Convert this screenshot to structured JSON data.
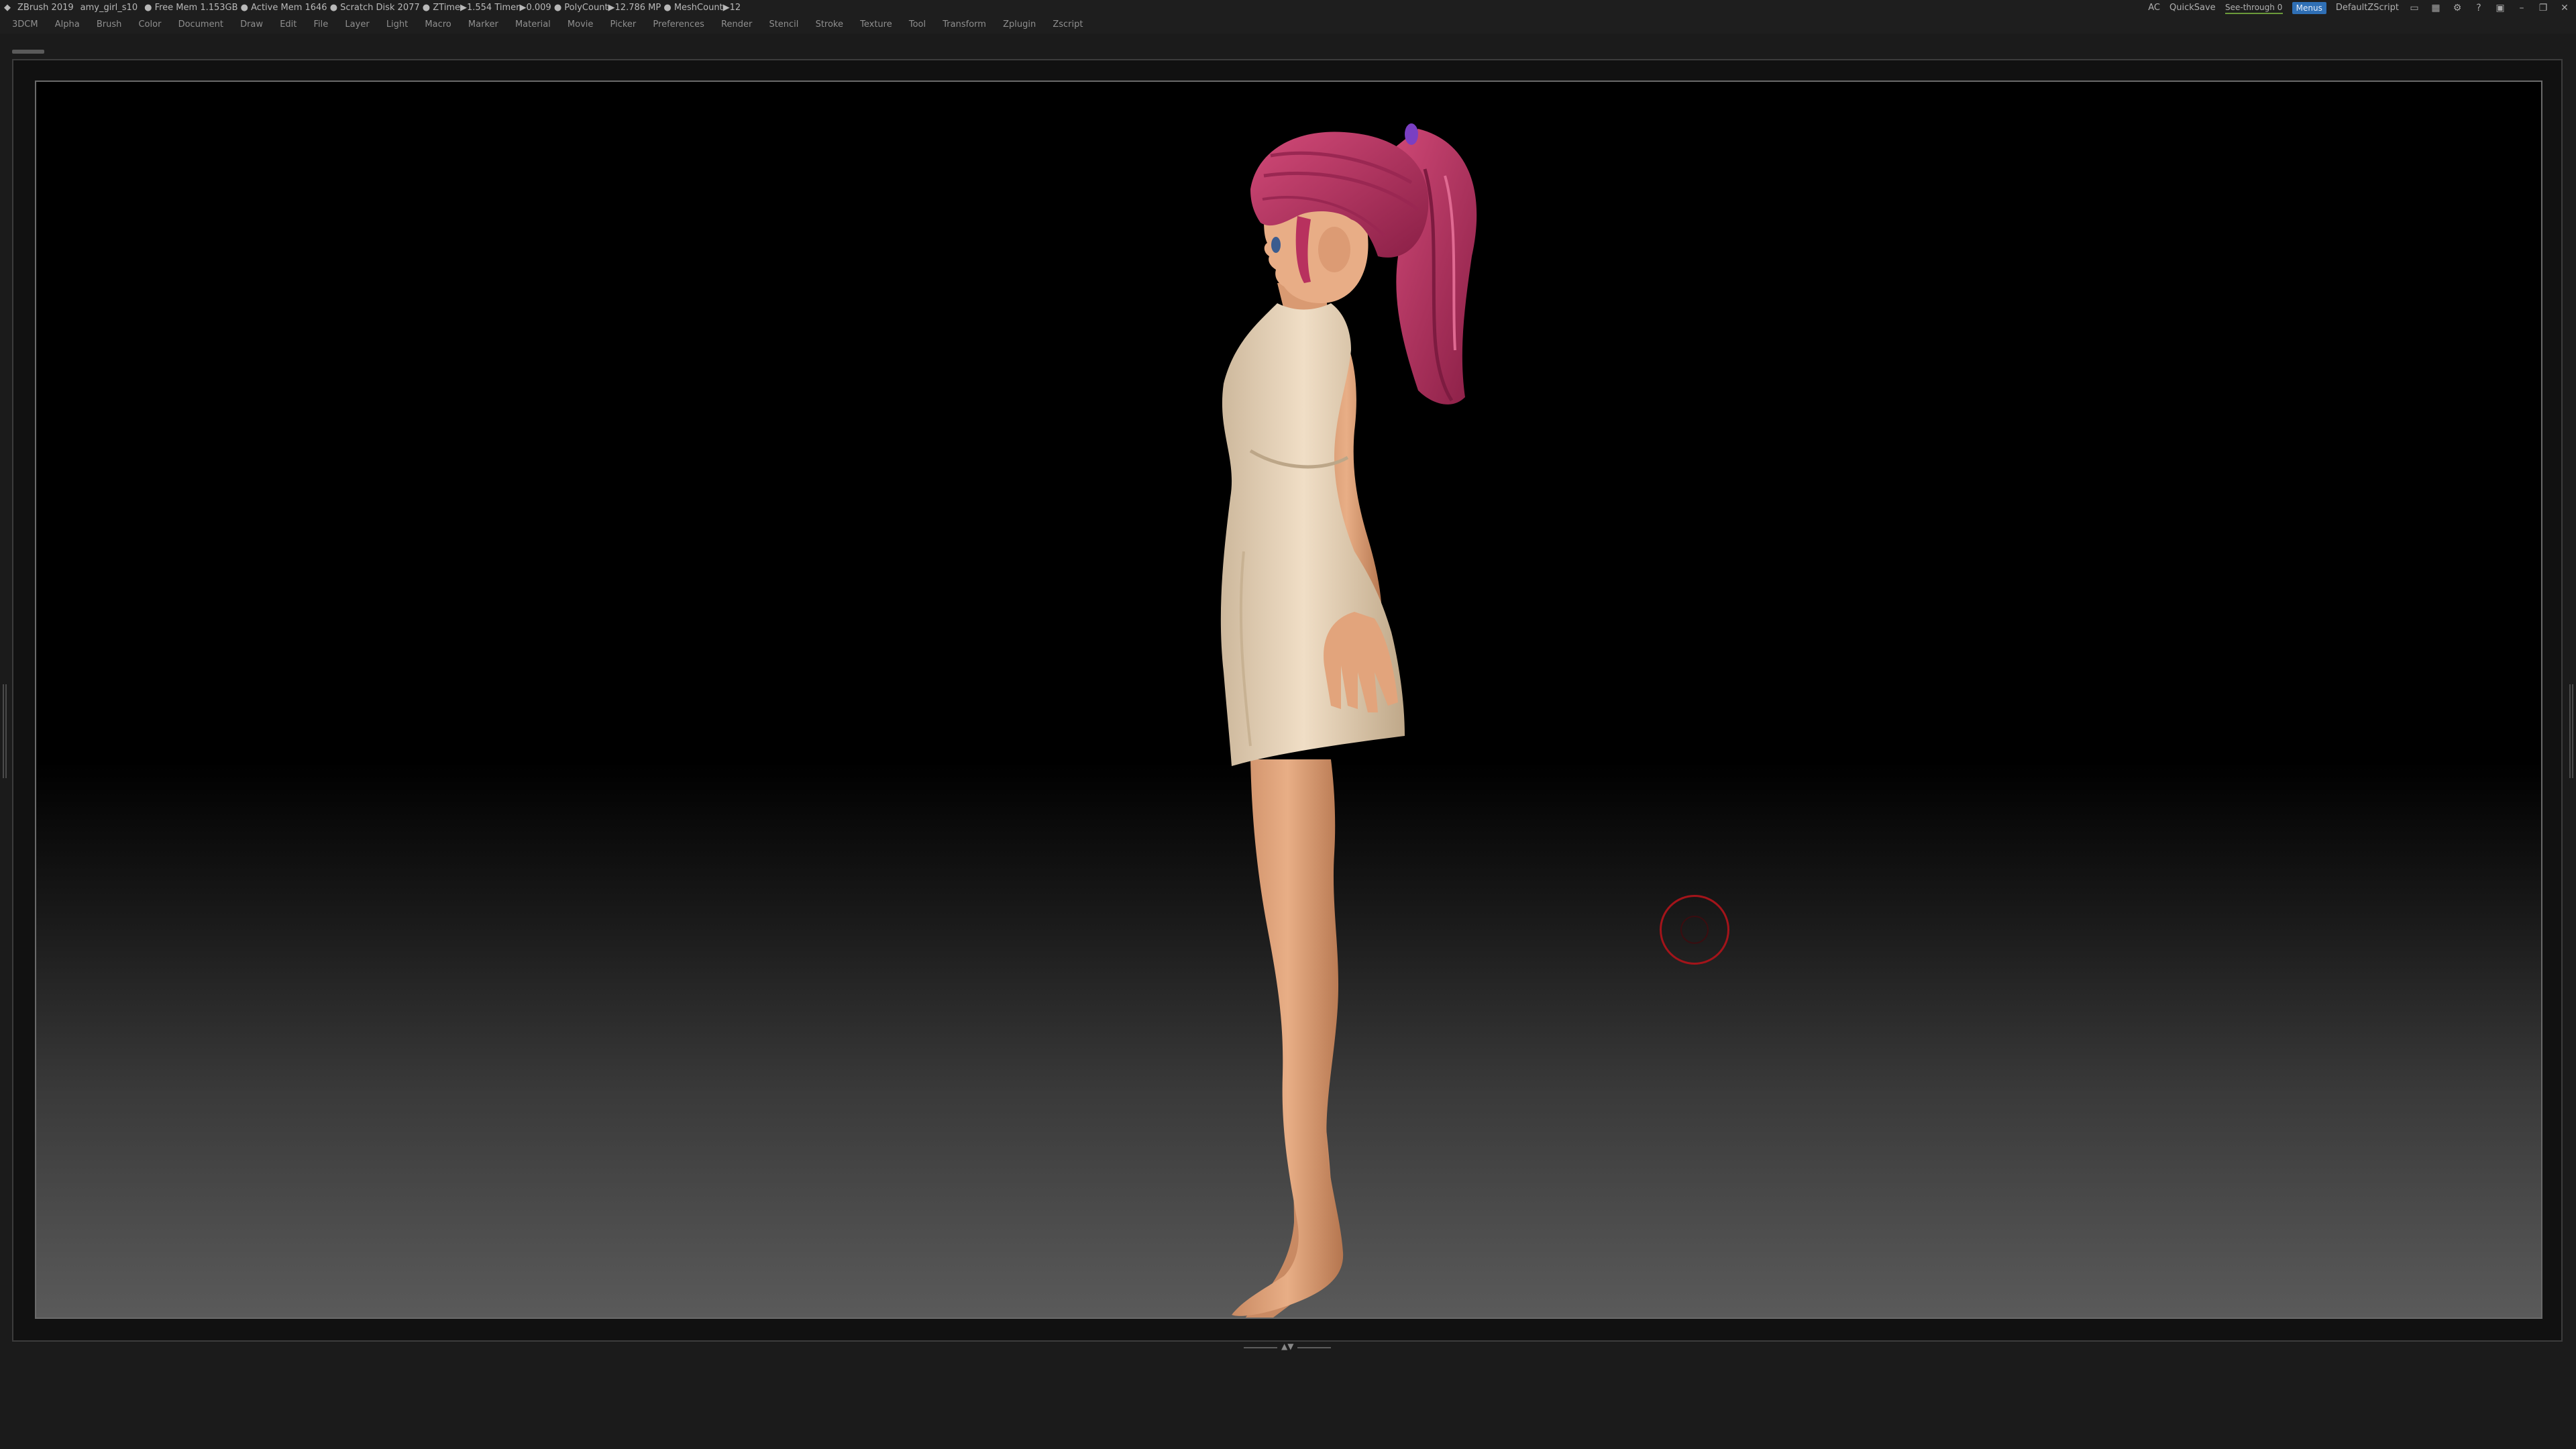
{
  "titlebar": {
    "app_name": "ZBrush 2019",
    "document_name": "amy_girl_s10",
    "stats": "● Free Mem 1.153GB ● Active Mem 1646 ● Scratch Disk 2077 ● ZTime▶1.554 Timer▶0.009 ● PolyCount▶12.786 MP ● MeshCount▶12",
    "ac_label": "AC",
    "quicksave_label": "QuickSave",
    "see_through_label": "See-through  0",
    "menus_label": "Menus",
    "default_script_label": "DefaultZScript"
  },
  "menubar": {
    "items": [
      "3DCM",
      "Alpha",
      "Brush",
      "Color",
      "Document",
      "Draw",
      "Edit",
      "File",
      "Layer",
      "Light",
      "Macro",
      "Marker",
      "Material",
      "Movie",
      "Picker",
      "Preferences",
      "Render",
      "Stencil",
      "Stroke",
      "Texture",
      "Tool",
      "Transform",
      "Zplugin",
      "Zscript"
    ]
  },
  "colors": {
    "hair": "#b8315e",
    "skin": "#e5a57d",
    "dress": "#e8d4ba",
    "brush_cursor": "#a3141a",
    "menus_highlight": "#2f6fb5"
  }
}
